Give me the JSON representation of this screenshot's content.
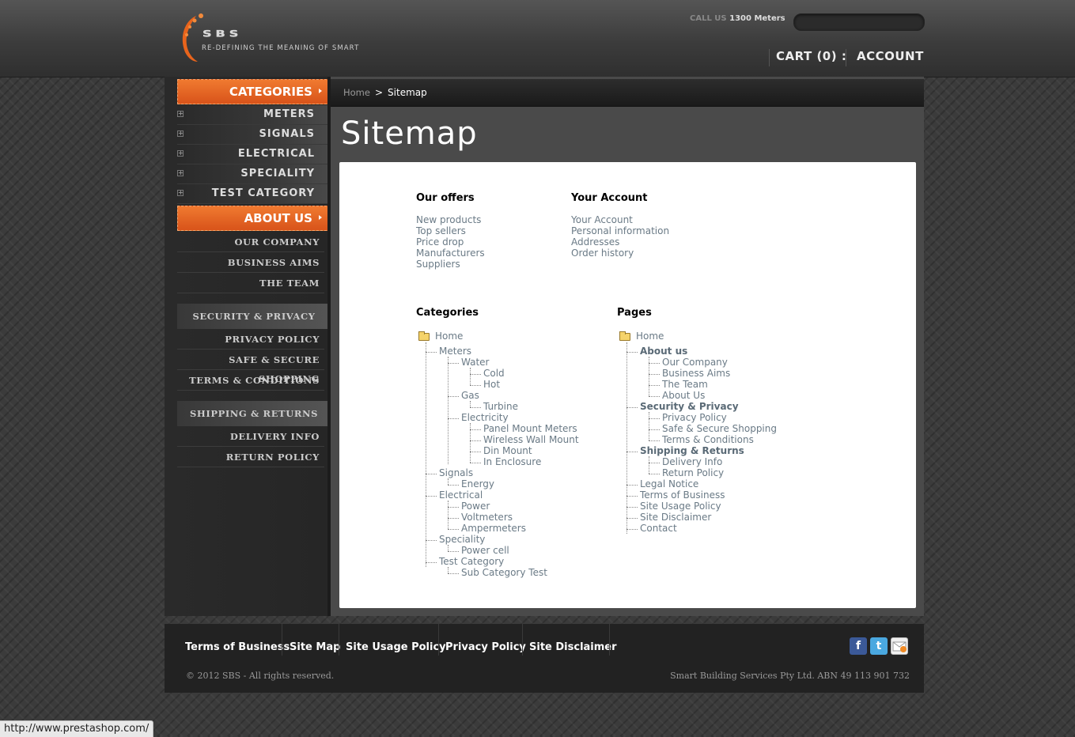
{
  "header": {
    "logo_text": "SBS",
    "logo_tagline": "RE-DEFINING THE MEANING OF SMART",
    "call_label": "CALL US",
    "call_value": "1300 Meters",
    "cart_label": "CART (0) :",
    "account_label": "ACCOUNT"
  },
  "sidebar": {
    "categories_title": "CATEGORIES",
    "categories": [
      "METERS",
      "SIGNALS",
      "ELECTRICAL",
      "SPECIALITY",
      "TEST CATEGORY"
    ],
    "about_title": "ABOUT US",
    "about_items": [
      "OUR COMPANY",
      "BUSINESS AIMS",
      "THE TEAM"
    ],
    "security_title": "SECURITY & PRIVACY",
    "security_items": [
      "PRIVACY POLICY",
      "SAFE & SECURE SHOPPING",
      "TERMS & CONDITIONS"
    ],
    "shipping_title": "SHIPPING & RETURNS",
    "shipping_items": [
      "DELIVERY INFO",
      "RETURN POLICY"
    ]
  },
  "breadcrumb": {
    "home": "Home",
    "separator": ">",
    "current": "Sitemap"
  },
  "page_title": "Sitemap",
  "offers": {
    "title": "Our offers",
    "links": [
      "New products",
      "Top sellers",
      "Price drop",
      "Manufacturers",
      "Suppliers"
    ]
  },
  "account": {
    "title": "Your Account",
    "links": [
      "Your Account",
      "Personal information",
      "Addresses",
      "Order history"
    ]
  },
  "categories_tree": {
    "title": "Categories",
    "root": "Home",
    "nodes": [
      "Meters",
      "Water",
      "Cold",
      "Hot",
      "Gas",
      "Turbine",
      "Electricity",
      "Panel Mount Meters",
      "Wireless Wall Mount",
      "Din Mount",
      "In Enclosure",
      "Signals",
      "Energy",
      "Electrical",
      "Power",
      "Voltmeters",
      "Ampermeters",
      "Speciality",
      "Power cell",
      "Test Category",
      "Sub Category Test"
    ]
  },
  "pages_tree": {
    "title": "Pages",
    "root": "Home",
    "nodes": [
      "About us",
      "Our Company",
      "Business Aims",
      "The Team",
      "About Us",
      "Security & Privacy",
      "Privacy Policy",
      "Safe & Secure Shopping",
      "Terms & Conditions",
      "Shipping & Returns",
      "Delivery Info",
      "Return Policy",
      "Legal Notice",
      "Terms of Business",
      "Site Usage Policy",
      "Site Disclaimer",
      "Contact"
    ]
  },
  "footer": {
    "links": [
      "Terms of Business",
      "Site Map",
      "Site Usage Policy",
      "Privacy Policy",
      "Site Disclaimer"
    ],
    "copyright": "© 2012 SBS - All rights reserved.",
    "abn": "Smart Building Services Pty Ltd. ABN 49 113 901 732",
    "social": [
      "facebook-icon",
      "twitter-icon",
      "rss-mail-icon"
    ]
  },
  "status_bar": "http://www.prestashop.com/",
  "colors": {
    "accent": "#e0601f",
    "link": "#6a7a86"
  }
}
